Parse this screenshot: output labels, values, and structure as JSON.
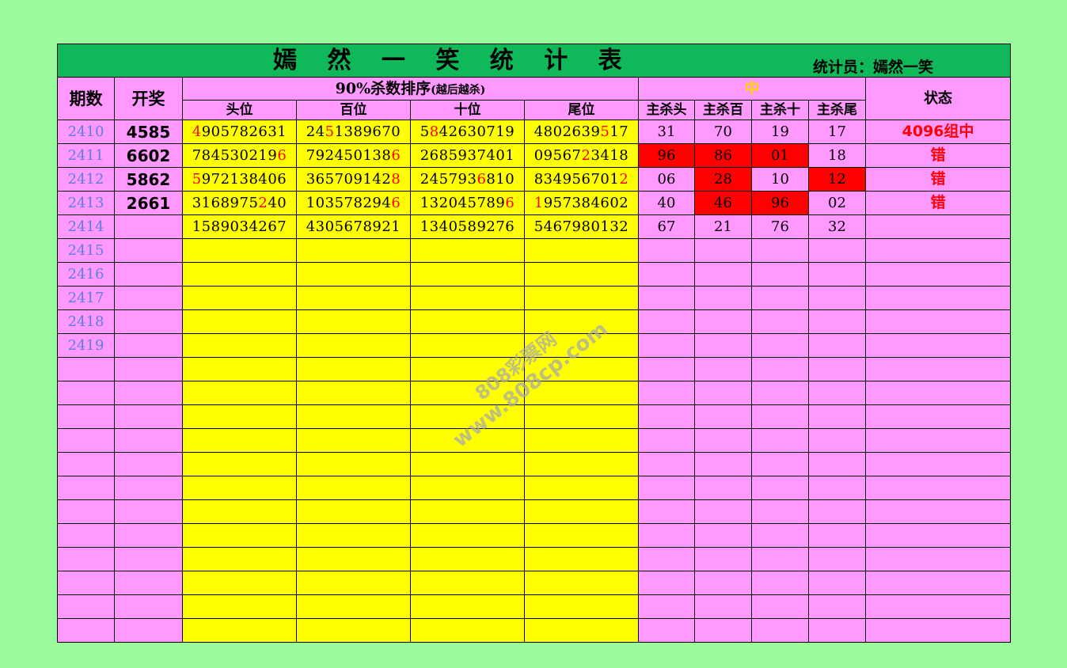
{
  "title": "嫣 然 一 笑 统 计 表",
  "statistician": "统计员：嫣然一笑",
  "headers": {
    "period": "期数",
    "draw": "开奖",
    "sequence_group": "90%杀数排序",
    "sequence_group_note": "(越后越杀)",
    "positions": [
      "头位",
      "百位",
      "十位",
      "尾位"
    ],
    "hit_group": "中",
    "kill_positions": [
      "主杀头",
      "主杀百",
      "主杀十",
      "主杀尾"
    ],
    "status": "状态"
  },
  "rows": [
    {
      "period": "2410",
      "draw": "4585",
      "seqs": [
        {
          "pre": "",
          "hit": "4",
          "post": "905782631"
        },
        {
          "pre": "24",
          "hit": "5",
          "post": "1389670"
        },
        {
          "pre": "5",
          "hit": "8",
          "post": "42630719"
        },
        {
          "pre": "4802639",
          "hit": "5",
          "post": "17"
        }
      ],
      "kills": [
        {
          "v": "31",
          "red": false
        },
        {
          "v": "70",
          "red": false
        },
        {
          "v": "19",
          "red": false
        },
        {
          "v": "17",
          "red": false
        }
      ],
      "status": "4096组中"
    },
    {
      "period": "2411",
      "draw": "6602",
      "seqs": [
        {
          "pre": "784530219",
          "hit": "6",
          "post": ""
        },
        {
          "pre": "792450138",
          "hit": "6",
          "post": ""
        },
        {
          "pre": "268593740",
          "hit": "",
          "post": "1"
        },
        {
          "pre": "09567",
          "hit": "2",
          "post": "3418"
        }
      ],
      "kills": [
        {
          "v": "96",
          "red": true
        },
        {
          "v": "86",
          "red": true
        },
        {
          "v": "01",
          "red": true
        },
        {
          "v": "18",
          "red": false
        }
      ],
      "status": "错"
    },
    {
      "period": "2412",
      "draw": "5862",
      "seqs": [
        {
          "pre": "",
          "hit": "5",
          "post": "972138406"
        },
        {
          "pre": "365709142",
          "hit": "8",
          "post": ""
        },
        {
          "pre": "245793",
          "hit": "6",
          "post": "810"
        },
        {
          "pre": "834956701",
          "hit": "2",
          "post": ""
        }
      ],
      "kills": [
        {
          "v": "06",
          "red": false
        },
        {
          "v": "28",
          "red": true
        },
        {
          "v": "10",
          "red": false
        },
        {
          "v": "12",
          "red": true
        }
      ],
      "status": "错"
    },
    {
      "period": "2413",
      "draw": "2661",
      "seqs": [
        {
          "pre": "3168975",
          "hit": "2",
          "post": "40"
        },
        {
          "pre": "103578294",
          "hit": "6",
          "post": ""
        },
        {
          "pre": "132045789",
          "hit": "6",
          "post": ""
        },
        {
          "pre": "",
          "hit": "1",
          "post": "957384602"
        }
      ],
      "kills": [
        {
          "v": "40",
          "red": false
        },
        {
          "v": "46",
          "red": true
        },
        {
          "v": "96",
          "red": true
        },
        {
          "v": "02",
          "red": false
        }
      ],
      "status": "错"
    },
    {
      "period": "2414",
      "draw": "",
      "seqs": [
        {
          "pre": "1589034267",
          "hit": "",
          "post": ""
        },
        {
          "pre": "4305678921",
          "hit": "",
          "post": ""
        },
        {
          "pre": "1340589276",
          "hit": "",
          "post": ""
        },
        {
          "pre": "5467980132",
          "hit": "",
          "post": ""
        }
      ],
      "kills": [
        {
          "v": "67",
          "red": false
        },
        {
          "v": "21",
          "red": false
        },
        {
          "v": "76",
          "red": false
        },
        {
          "v": "32",
          "red": false
        }
      ],
      "status": ""
    },
    {
      "period": "2415",
      "draw": "",
      "seqs": [],
      "kills": [],
      "status": ""
    },
    {
      "period": "2416",
      "draw": "",
      "seqs": [],
      "kills": [],
      "status": ""
    },
    {
      "period": "2417",
      "draw": "",
      "seqs": [],
      "kills": [],
      "status": ""
    },
    {
      "period": "2418",
      "draw": "",
      "seqs": [],
      "kills": [],
      "status": ""
    },
    {
      "period": "2419",
      "draw": "",
      "seqs": [],
      "kills": [],
      "status": ""
    },
    {
      "period": "",
      "draw": "",
      "seqs": [],
      "kills": [],
      "status": ""
    },
    {
      "period": "",
      "draw": "",
      "seqs": [],
      "kills": [],
      "status": ""
    },
    {
      "period": "",
      "draw": "",
      "seqs": [],
      "kills": [],
      "status": ""
    },
    {
      "period": "",
      "draw": "",
      "seqs": [],
      "kills": [],
      "status": ""
    },
    {
      "period": "",
      "draw": "",
      "seqs": [],
      "kills": [],
      "status": ""
    },
    {
      "period": "",
      "draw": "",
      "seqs": [],
      "kills": [],
      "status": ""
    },
    {
      "period": "",
      "draw": "",
      "seqs": [],
      "kills": [],
      "status": ""
    },
    {
      "period": "",
      "draw": "",
      "seqs": [],
      "kills": [],
      "status": ""
    },
    {
      "period": "",
      "draw": "",
      "seqs": [],
      "kills": [],
      "status": ""
    },
    {
      "period": "",
      "draw": "",
      "seqs": [],
      "kills": [],
      "status": ""
    },
    {
      "period": "",
      "draw": "",
      "seqs": [],
      "kills": [],
      "status": ""
    },
    {
      "period": "",
      "draw": "",
      "seqs": [],
      "kills": [],
      "status": ""
    }
  ],
  "watermark": {
    "line1": "808彩票网",
    "line2": "www.808cp.com"
  },
  "colors": {
    "background": "#9bfa9b",
    "title_bar": "#0fb858",
    "pink": "#ff99ff",
    "yellow": "#ffff00",
    "red": "#ff0000",
    "period_blue": "#5b7fe0",
    "gold": "#ffd700"
  }
}
